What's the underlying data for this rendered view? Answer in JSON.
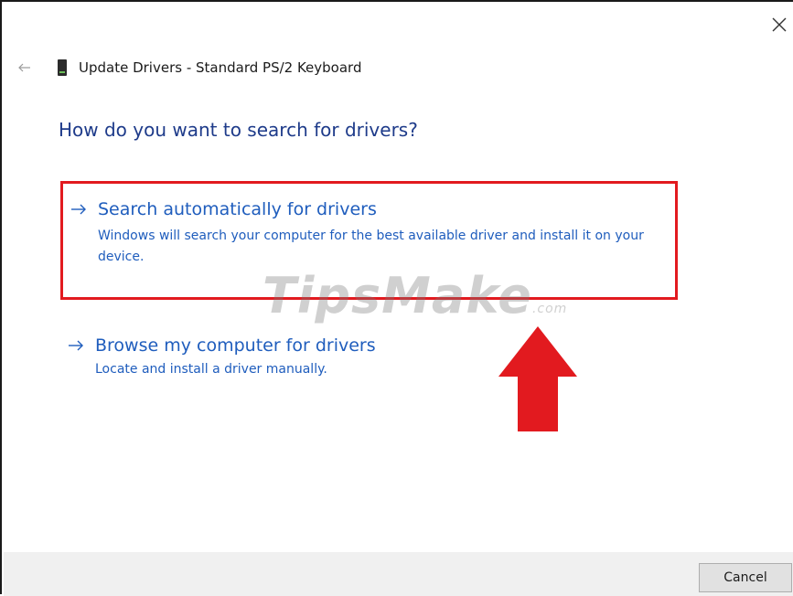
{
  "window": {
    "title": "Update Drivers - Standard PS/2 Keyboard"
  },
  "icons": {
    "close": "close-icon",
    "back": "back-arrow-icon",
    "device": "keyboard-device-icon",
    "option_arrow": "right-arrow-icon",
    "annotation": "red-up-arrow-icon"
  },
  "main": {
    "question": "How do you want to search for drivers?",
    "options": [
      {
        "title": "Search automatically for drivers",
        "description": "Windows will search your computer for the best available driver and install it on your device.",
        "highlighted": true
      },
      {
        "title": "Browse my computer for drivers",
        "description": "Locate and install a driver manually.",
        "highlighted": false
      }
    ]
  },
  "watermark": {
    "text": "TipsMake",
    "suffix": ".com"
  },
  "footer": {
    "cancel_label": "Cancel"
  },
  "colors": {
    "link_blue": "#1f5dbd",
    "heading_blue": "#1e3b8a",
    "highlight_red": "#e21a1f",
    "footer_gray": "#f0f0f0"
  }
}
